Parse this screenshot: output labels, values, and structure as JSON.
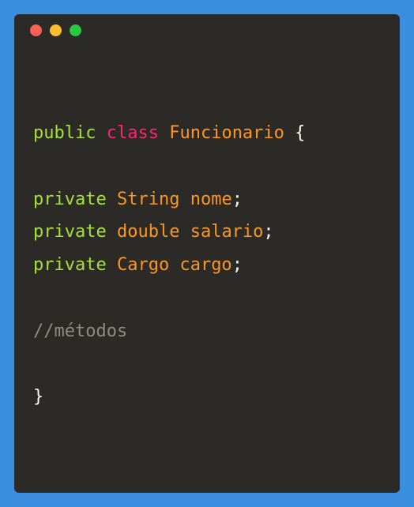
{
  "code": {
    "line1": {
      "public": "public",
      "class": "class",
      "classname": "Funcionario",
      "brace": "{"
    },
    "field1": {
      "private": "private",
      "type": "String",
      "name": "nome",
      "semi": ";"
    },
    "field2": {
      "private": "private",
      "type": "double",
      "name": "salario",
      "semi": ";"
    },
    "field3": {
      "private": "private",
      "type": "Cargo",
      "name": "cargo",
      "semi": ";"
    },
    "comment": "//métodos",
    "closeBrace": "}"
  },
  "colors": {
    "background": "#2b2a26",
    "frame": "#3b8ee0",
    "trafficRed": "#ff5f56",
    "trafficYellow": "#ffbd2e",
    "trafficGreen": "#27c93f",
    "keyword": "#a6e22e",
    "classKeyword": "#f92672",
    "type": "#fd971f",
    "comment": "#8d8d84",
    "text": "#f8f8f2"
  }
}
